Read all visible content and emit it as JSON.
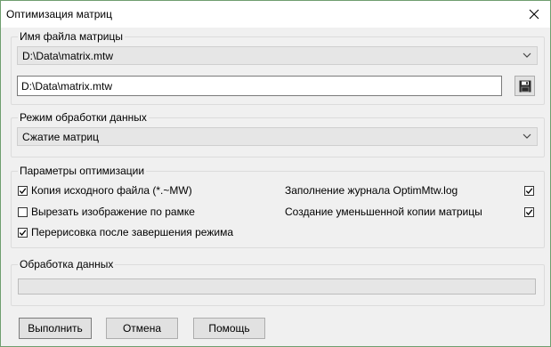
{
  "window": {
    "title": "Оптимизация матриц"
  },
  "file_group": {
    "legend": "Имя файла матрицы",
    "combo_value": "D:\\Data\\matrix.mtw",
    "text_value": "D:\\Data\\matrix.mtw"
  },
  "mode_group": {
    "legend": "Режим обработки данных",
    "combo_value": "Сжатие матриц"
  },
  "options_group": {
    "legend": "Параметры оптимизации",
    "copy_source": {
      "label": "Копия исходного файла (*.~MW)",
      "checked": true
    },
    "crop_image": {
      "label": "Вырезать изображение по рамке",
      "checked": false
    },
    "redraw_after": {
      "label": "Перерисовка после завершения режима",
      "checked": true
    },
    "fill_log": {
      "label": "Заполнение журнала OptimMtw.log",
      "checked": true
    },
    "reduced_copy": {
      "label": "Создание уменьшенной копии матрицы",
      "checked": true
    }
  },
  "processing_group": {
    "legend": "Обработка данных",
    "progress": 0
  },
  "buttons": {
    "run": "Выполнить",
    "cancel": "Отмена",
    "help": "Помощь"
  },
  "icons": {
    "close": "close-icon",
    "save": "save-floppy-icon",
    "dropdown": "chevron-down-icon"
  }
}
